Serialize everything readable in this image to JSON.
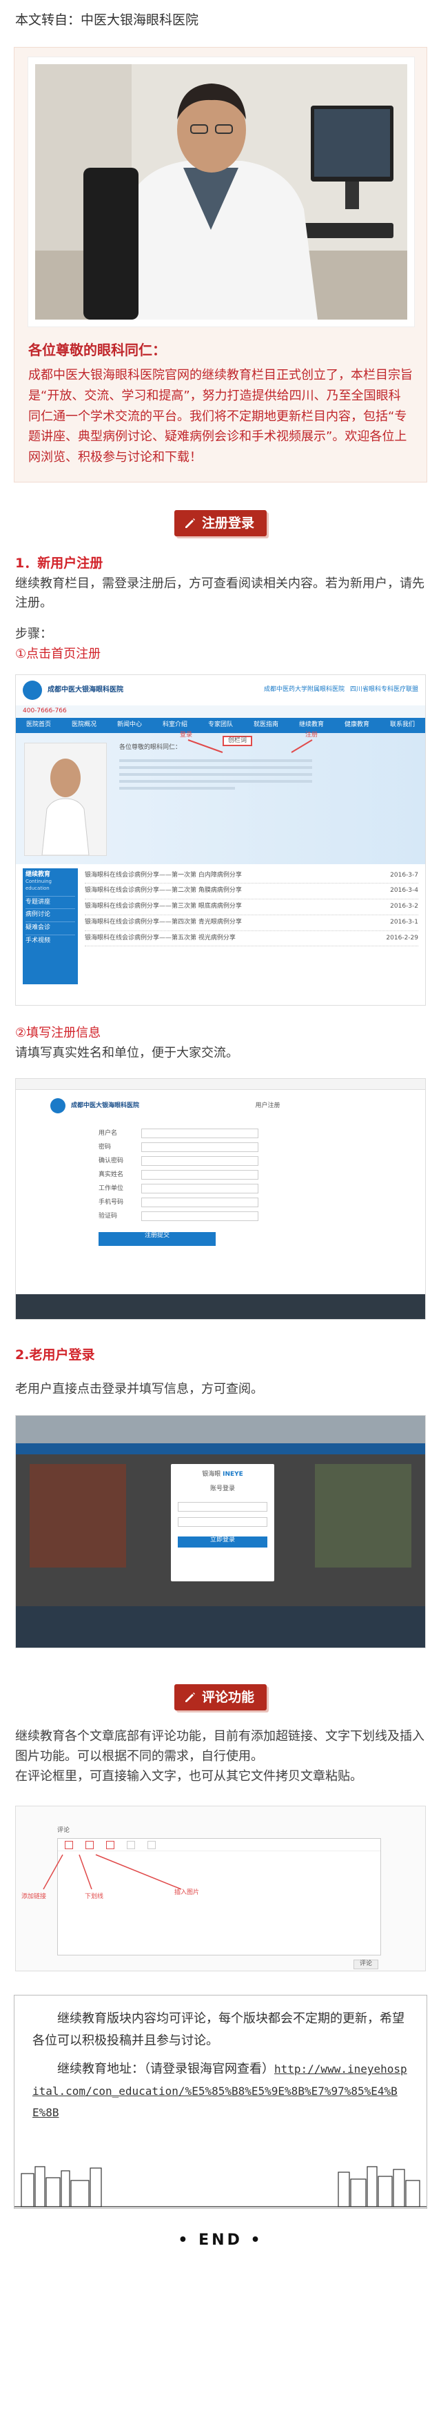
{
  "repost_line": "本文转自：中医大银海眼科医院",
  "greeting": {
    "title": "各位尊敬的眼科同仁：",
    "body": "成都中医大银海眼科医院官网的继续教育栏目正式创立了，本栏目宗旨是“开放、交流、学习和提高”，努力打造提供给四川、乃至全国眼科同仁通一个学术交流的平台。我们将不定期地更新栏目内容，包括“专题讲座、典型病例讨论、疑难病例会诊和手术视频展示”。欢迎各位上网浏览、积极参与讨论和下载！"
  },
  "sections": {
    "register_banner": "注册登录",
    "new_user_title": "1．新用户注册",
    "new_user_text": "继续教育栏目，需登录注册后，方可查看阅读相关内容。若为新用户，请先注册。",
    "steps_label": "步骤：",
    "step1": "①点击首页注册",
    "step2": "②填写注册信息",
    "step2_text": "请填写真实姓名和单位，便于大家交流。",
    "old_user_title": "2.老用户登录",
    "old_user_text": "老用户直接点击登录并填写信息，方可查阅。",
    "comment_banner": "评论功能",
    "comment_text": "继续教育各个文章底部有评论功能，目前有添加超链接、文字下划线及插入图片功能。可以根据不同的需求，自行使用。\n在评论框里，可直接输入文字，也可从其它文件拷贝文章粘贴。"
  },
  "homepage_shot": {
    "hospital_name": "成都中医大银海眼科医院",
    "hospital_name2": "成都中医药大学附属眼科医院",
    "hospital_name3": "四川省眼科专科医疗联盟",
    "nav": [
      "医院首页",
      "医院概况",
      "新闻中心",
      "科室介绍",
      "专家团队",
      "就医指南",
      "继续教育",
      "健康教育",
      "联系我们"
    ],
    "label_login": "登录",
    "label_register": "注册",
    "label_column": "创栏词",
    "welcome": "各位尊敬的眼科同仁：",
    "sidebar_title": "继续教育",
    "sidebar_sub": "Continuing education",
    "sidebar_items": [
      "专题讲座",
      "病例讨论",
      "疑难会诊",
      "手术视频"
    ],
    "list_items": [
      "银海眼科在线会诊病例分享——第一次第 白内障病例分享",
      "银海眼科在线会诊病例分享——第二次第 角膜病病例分享",
      "银海眼科在线会诊病例分享——第三次第 眼底病病例分享",
      "银海眼科在线会诊病例分享——第四次第 青光眼病例分享",
      "银海眼科在线会诊病例分享——第五次第 视光病例分享"
    ],
    "list_dates": [
      "2016-3-7",
      "2016-3-4",
      "2016-3-2",
      "2016-3-1",
      "2016-2-29"
    ],
    "phone": "400-7666-766"
  },
  "register_shot": {
    "form_title": "用户注册",
    "fields": [
      "用户名",
      "密码",
      "确认密码",
      "真实姓名",
      "工作单位",
      "手机号码",
      "验证码"
    ],
    "submit": "注册提交"
  },
  "login_shot": {
    "modal_title": "账号登录",
    "brand": "INEYE",
    "brand_cn": "银海眼",
    "submit": "立即登录"
  },
  "comment_shot": {
    "tab": "评论",
    "label_link": "添加链接",
    "label_underline": "下划线",
    "label_image": "插入图片",
    "submit": "评论"
  },
  "note": {
    "line1": "继续教育版块内容均可评论，每个版块都会不定期的更新，希望各位可以积极投稿并且参与讨论。",
    "line2": "继续教育地址：（请登录银海官网查看）",
    "url": "http://www.ineyehospital.com/con_education/%E5%85%B8%E5%9E%8B%E7%97%85%E4%BE%8B"
  },
  "end_text": "• END •",
  "colors": {
    "accent": "#b32a1e",
    "red_text": "#d2232a",
    "site_blue": "#1a7ac8"
  }
}
